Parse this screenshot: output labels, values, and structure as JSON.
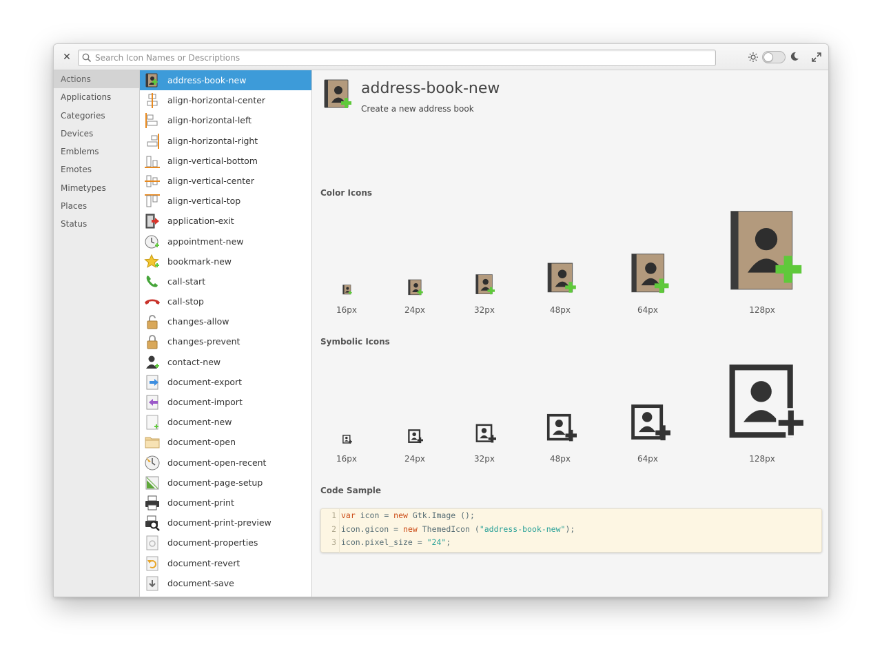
{
  "search": {
    "placeholder": "Search Icon Names or Descriptions"
  },
  "header": {
    "close_icon": "close-icon",
    "light_icon": "sun-icon",
    "dark_icon": "moon-icon",
    "maximize_icon": "maximize-icon"
  },
  "categories": [
    "Actions",
    "Applications",
    "Categories",
    "Devices",
    "Emblems",
    "Emotes",
    "Mimetypes",
    "Places",
    "Status"
  ],
  "selected_category": "Actions",
  "icons": [
    "address-book-new",
    "align-horizontal-center",
    "align-horizontal-left",
    "align-horizontal-right",
    "align-vertical-bottom",
    "align-vertical-center",
    "align-vertical-top",
    "application-exit",
    "appointment-new",
    "bookmark-new",
    "call-start",
    "call-stop",
    "changes-allow",
    "changes-prevent",
    "contact-new",
    "document-export",
    "document-import",
    "document-new",
    "document-open",
    "document-open-recent",
    "document-page-setup",
    "document-print",
    "document-print-preview",
    "document-properties",
    "document-revert",
    "document-save"
  ],
  "detail": {
    "name": "address-book-new",
    "description": "Create a new address book",
    "color_heading": "Color Icons",
    "symbolic_heading": "Symbolic Icons",
    "code_heading": "Code Sample",
    "sizes": [
      "16px",
      "24px",
      "32px",
      "48px",
      "64px",
      "128px"
    ]
  },
  "code": {
    "line_numbers": [
      "1",
      "2",
      "3"
    ],
    "l1": {
      "kw1": "var",
      "a": " icon = ",
      "kw2": "new",
      "b": " Gtk.Image ();"
    },
    "l2": {
      "a": "icon.gicon = ",
      "kw": "new",
      "b": " ThemedIcon (",
      "str": "\"address-book-new\"",
      "c": ");"
    },
    "l3": {
      "a": "icon.pixel_size = ",
      "str": "\"24\"",
      "b": ";"
    }
  },
  "colors": {
    "selection": "#3d9bd9",
    "book": "#b39a7d",
    "plus": "#5fc93b",
    "symbolic": "#333333"
  }
}
